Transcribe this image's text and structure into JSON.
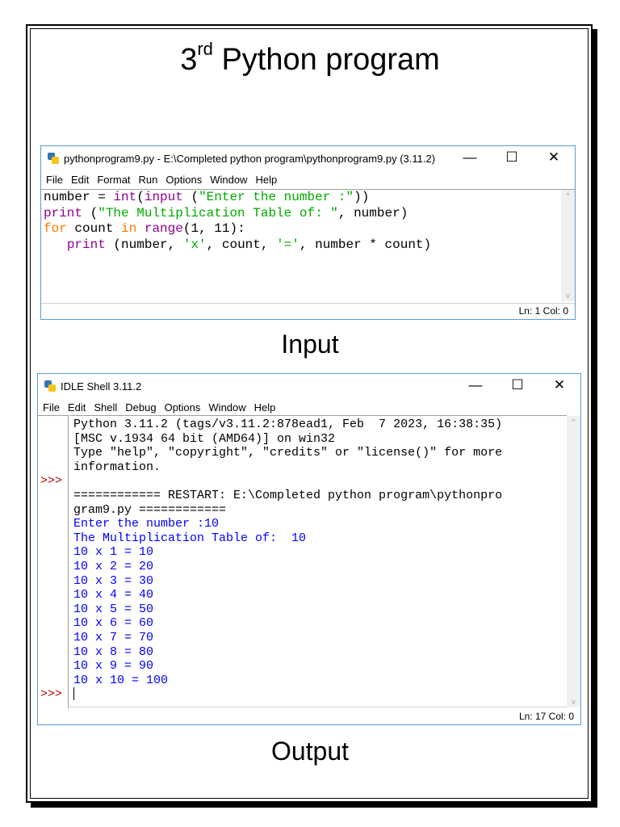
{
  "page": {
    "title_ordinal": "3",
    "title_suffix": "rd",
    "title_rest": " Python program",
    "input_caption": "Input",
    "output_caption": "Output"
  },
  "editor": {
    "title": "pythonprogram9.py - E:\\Completed python program\\pythonprogram9.py (3.11.2)",
    "menu": [
      "File",
      "Edit",
      "Format",
      "Run",
      "Options",
      "Window",
      "Help"
    ],
    "controls": {
      "minimize": "—",
      "maximize": "☐",
      "close": "✕"
    },
    "lines": [
      [
        [
          "pl",
          "number = "
        ],
        [
          "bi",
          "int"
        ],
        [
          "pl",
          "("
        ],
        [
          "bi",
          "input"
        ],
        [
          "pl",
          " ("
        ],
        [
          "st",
          "\"Enter the number :\""
        ],
        [
          "pl",
          "))"
        ]
      ],
      [
        [
          "bi",
          "print"
        ],
        [
          "pl",
          " ("
        ],
        [
          "st",
          "\"The Multiplication Table of: \""
        ],
        [
          "pl",
          ", number)"
        ]
      ],
      [
        [
          "kw",
          "for"
        ],
        [
          "pl",
          " count "
        ],
        [
          "kw",
          "in"
        ],
        [
          "pl",
          " "
        ],
        [
          "bi",
          "range"
        ],
        [
          "pl",
          "(1, 11):"
        ]
      ],
      [
        [
          "pl",
          "   "
        ],
        [
          "bi",
          "print"
        ],
        [
          "pl",
          " (number, "
        ],
        [
          "st",
          "'x'"
        ],
        [
          "pl",
          ", count, "
        ],
        [
          "st",
          "'='"
        ],
        [
          "pl",
          ", number * count)"
        ]
      ]
    ],
    "status": "Ln: 1   Col: 0"
  },
  "shell": {
    "title": "IDLE Shell 3.11.2",
    "menu": [
      "File",
      "Edit",
      "Shell",
      "Debug",
      "Options",
      "Window",
      "Help"
    ],
    "controls": {
      "minimize": "—",
      "maximize": "☐",
      "close": "✕"
    },
    "lines": [
      {
        "prompt": "",
        "cls": "sys",
        "text": "Python 3.11.2 (tags/v3.11.2:878ead1, Feb  7 2023, 16:38:35)"
      },
      {
        "prompt": "",
        "cls": "sys",
        "text": "[MSC v.1934 64 bit (AMD64)] on win32"
      },
      {
        "prompt": "",
        "cls": "sys",
        "text": "Type \"help\", \"copyright\", \"credits\" or \"license()\" for more"
      },
      {
        "prompt": "",
        "cls": "sys",
        "text": "information."
      },
      {
        "prompt": ">>>",
        "cls": "sys",
        "text": ""
      },
      {
        "prompt": "",
        "cls": "sys",
        "text": "============ RESTART: E:\\Completed python program\\pythonpro"
      },
      {
        "prompt": "",
        "cls": "sys",
        "text": "gram9.py ============"
      },
      {
        "prompt": "",
        "cls": "out",
        "text": "Enter the number :10"
      },
      {
        "prompt": "",
        "cls": "out",
        "text": "The Multiplication Table of:  10"
      },
      {
        "prompt": "",
        "cls": "out",
        "text": "10 x 1 = 10"
      },
      {
        "prompt": "",
        "cls": "out",
        "text": "10 x 2 = 20"
      },
      {
        "prompt": "",
        "cls": "out",
        "text": "10 x 3 = 30"
      },
      {
        "prompt": "",
        "cls": "out",
        "text": "10 x 4 = 40"
      },
      {
        "prompt": "",
        "cls": "out",
        "text": "10 x 5 = 50"
      },
      {
        "prompt": "",
        "cls": "out",
        "text": "10 x 6 = 60"
      },
      {
        "prompt": "",
        "cls": "out",
        "text": "10 x 7 = 70"
      },
      {
        "prompt": "",
        "cls": "out",
        "text": "10 x 8 = 80"
      },
      {
        "prompt": "",
        "cls": "out",
        "text": "10 x 9 = 90"
      },
      {
        "prompt": "",
        "cls": "out",
        "text": "10 x 10 = 100"
      },
      {
        "prompt": ">>>",
        "cls": "sys",
        "text": "",
        "cursor": true
      }
    ],
    "status": "Ln: 17   Col: 0"
  }
}
